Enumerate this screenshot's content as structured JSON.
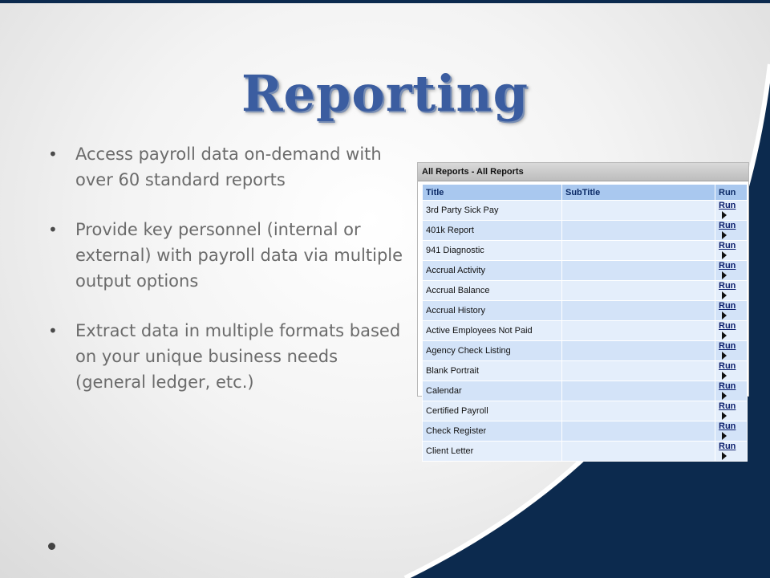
{
  "slide": {
    "title": "Reporting",
    "bullets": [
      "Access payroll data on-demand with over 60 standard reports",
      "Provide key personnel (internal or external) with payroll data via multiple output options",
      "Extract data in multiple formats based on your unique business needs (general ledger, etc.)"
    ],
    "colors": {
      "title": "#3b5da0",
      "accent_navy": "#0c2a4e",
      "body_text": "#6b6b6b"
    }
  },
  "report_panel": {
    "header": "All Reports - All Reports",
    "columns": [
      "Title",
      "SubTitle",
      "Run"
    ],
    "rows": [
      {
        "title": "3rd Party Sick Pay",
        "subtitle": "",
        "run": "Run"
      },
      {
        "title": "401k Report",
        "subtitle": "",
        "run": "Run"
      },
      {
        "title": "941 Diagnostic",
        "subtitle": "",
        "run": "Run"
      },
      {
        "title": "Accrual Activity",
        "subtitle": "",
        "run": "Run"
      },
      {
        "title": "Accrual Balance",
        "subtitle": "",
        "run": "Run"
      },
      {
        "title": "Accrual History",
        "subtitle": "",
        "run": "Run"
      },
      {
        "title": "Active Employees Not Paid",
        "subtitle": "",
        "run": "Run"
      },
      {
        "title": "Agency Check Listing",
        "subtitle": "",
        "run": "Run"
      },
      {
        "title": "Blank Portrait",
        "subtitle": "",
        "run": "Run"
      },
      {
        "title": "Calendar",
        "subtitle": "",
        "run": "Run"
      },
      {
        "title": "Certified Payroll",
        "subtitle": "",
        "run": "Run"
      },
      {
        "title": "Check Register",
        "subtitle": "",
        "run": "Run"
      },
      {
        "title": "Client Letter",
        "subtitle": "",
        "run": "Run"
      }
    ],
    "icons": {
      "run": "play-arrow-icon"
    }
  }
}
